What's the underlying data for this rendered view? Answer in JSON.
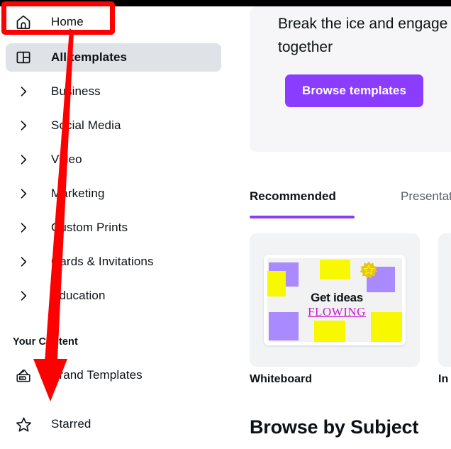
{
  "app": {
    "accent_purple": "#8b3dff",
    "annotation_color": "#ff0000",
    "active_row_bg": "#dfe2e6"
  },
  "sidebar": {
    "items": [
      {
        "label": "Home",
        "icon": "home-icon",
        "type": "icon",
        "active": false
      },
      {
        "label": "All templates",
        "icon": "templates-grid-icon",
        "type": "icon",
        "active": true
      },
      {
        "label": "Business",
        "icon": "chevron-right-icon",
        "type": "chevron",
        "active": false
      },
      {
        "label": "Social Media",
        "icon": "chevron-right-icon",
        "type": "chevron",
        "active": false
      },
      {
        "label": "Video",
        "icon": "chevron-right-icon",
        "type": "chevron",
        "active": false
      },
      {
        "label": "Marketing",
        "icon": "chevron-right-icon",
        "type": "chevron",
        "active": false
      },
      {
        "label": "Custom Prints",
        "icon": "chevron-right-icon",
        "type": "chevron",
        "active": false
      },
      {
        "label": "Cards & Invitations",
        "icon": "chevron-right-icon",
        "type": "chevron",
        "active": false
      },
      {
        "label": "Education",
        "icon": "chevron-right-icon",
        "type": "chevron",
        "active": false
      }
    ],
    "section_header": "Your Content",
    "content_items": [
      {
        "label": "Brand Templates",
        "icon": "brand-stamp-icon"
      },
      {
        "label": "Starred",
        "icon": "star-outline-icon"
      }
    ]
  },
  "main": {
    "banner": {
      "title": "Break the ice and engage\ntogether",
      "button_label": "Browse templates"
    },
    "tabs": [
      {
        "label": "Recommended",
        "active": true
      },
      {
        "label": "Presentati",
        "active": false
      }
    ],
    "cards": [
      {
        "label": "Whiteboard",
        "thumb": {
          "heading": "Get ideas",
          "subheading": "FLOWING",
          "badge": "star-badge-icon"
        }
      },
      {
        "label": "In",
        "thumb": {}
      }
    ],
    "section_title": "Browse by Subject"
  },
  "annotation": {
    "highlight_target": "Home",
    "arrow_target": "Starred",
    "shape": "down-arrow"
  }
}
